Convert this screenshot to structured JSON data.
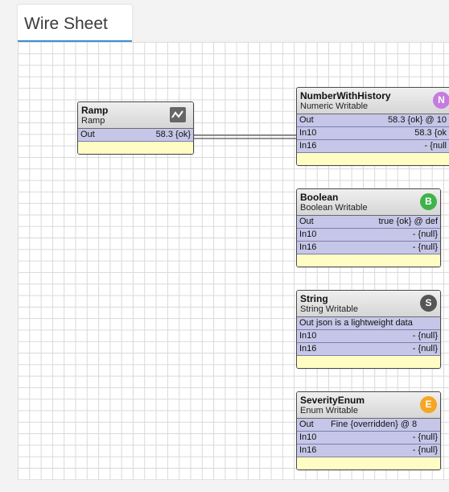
{
  "view": {
    "tab_title": "Wire Sheet"
  },
  "nodes": {
    "ramp": {
      "name": "Ramp",
      "type": "Ramp",
      "slots": [
        {
          "label": "Out",
          "value": "58.3 {ok}"
        }
      ]
    },
    "number_with_history": {
      "name": "NumberWithHistory",
      "type": "Numeric Writable",
      "icon_letter": "N",
      "icon_color": "#c57ce0",
      "slots": [
        {
          "label": "Out",
          "value": "58.3 {ok} @ 10"
        },
        {
          "label": "In10",
          "value": "58.3 {ok"
        },
        {
          "label": "In16",
          "value": "- {null"
        }
      ]
    },
    "boolean": {
      "name": "Boolean",
      "type": "Boolean Writable",
      "icon_letter": "B",
      "icon_color": "#3fb24a",
      "slots": [
        {
          "label": "Out",
          "value": "true {ok} @ def"
        },
        {
          "label": "In10",
          "value": "- {null}"
        },
        {
          "label": "In16",
          "value": "- {null}"
        }
      ]
    },
    "string": {
      "name": "String",
      "type": "String Writable",
      "icon_letter": "S",
      "icon_color": "#555555",
      "slots": [
        {
          "label": "Out",
          "value": "json is a lightweight data"
        },
        {
          "label": "In10",
          "value": "- {null}"
        },
        {
          "label": "In16",
          "value": "- {null}"
        }
      ]
    },
    "severity_enum": {
      "name": "SeverityEnum",
      "type": "Enum Writable",
      "icon_letter": "E",
      "icon_color": "#f5a623",
      "slots": [
        {
          "label": "Out",
          "value": "Fine {overridden} @ 8"
        },
        {
          "label": "In10",
          "value": "- {null}"
        },
        {
          "label": "In16",
          "value": "- {null}"
        }
      ]
    }
  },
  "links": [
    {
      "from": "Ramp.Out",
      "to": "NumberWithHistory.In10"
    }
  ],
  "colors": {
    "slot_bg": "#c6c7e8",
    "node_footer": "#fffdc4",
    "tab_accent": "#3b8fd8",
    "grid_line": "#d9d9d9"
  }
}
